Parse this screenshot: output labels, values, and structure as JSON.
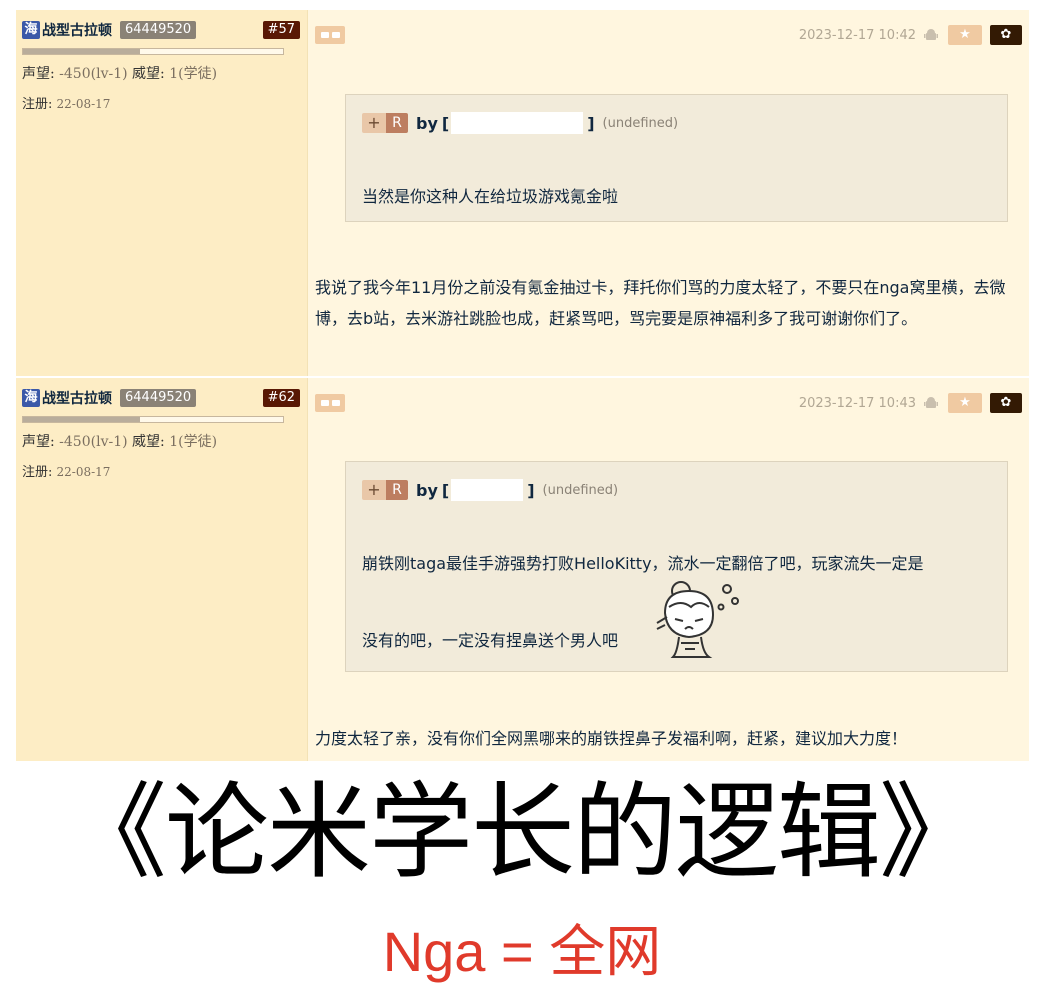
{
  "posts": [
    {
      "user": {
        "badge": "海",
        "name": "战型古拉顿",
        "uid": "64449520",
        "floor": "#57",
        "prestige_label": "声望: ",
        "prestige_value": "-450(lv-1)",
        "authority_label": " 威望: ",
        "authority_value": "1(学徒)",
        "reg_label": "注册: ",
        "reg_value": "22-08-17"
      },
      "date": "2023-12-17 10:42",
      "quote": {
        "plus": "+",
        "r": "R",
        "by": "by",
        "open_bracket": "[",
        "close_bracket": "]",
        "undefined": "(undefined)",
        "text": "当然是你这种人在给垃圾游戏氪金啦"
      },
      "body": "我说了我今年11月份之前没有氪金抽过卡，拜托你们骂的力度太轻了，不要只在nga窝里横，去微博，去b站，去米游社跳脸也成，赶紧骂吧，骂完要是原神福利多了我可谢谢你们了。"
    },
    {
      "user": {
        "badge": "海",
        "name": "战型古拉顿",
        "uid": "64449520",
        "floor": "#62",
        "prestige_label": "声望: ",
        "prestige_value": "-450(lv-1)",
        "authority_label": " 威望: ",
        "authority_value": "1(学徒)",
        "reg_label": "注册: ",
        "reg_value": "22-08-17"
      },
      "date": "2023-12-17 10:43",
      "quote": {
        "plus": "+",
        "r": "R",
        "by": "by",
        "open_bracket": "[",
        "close_bracket": "]",
        "undefined": "(undefined)",
        "text_line1": "崩铁刚taga最佳手游强势打败HelloKitty，流水一定翻倍了吧，玩家流失一定是",
        "text_line2": "没有的吧，一定没有捏鼻送个男人吧"
      },
      "body": "力度太轻了亲，没有你们全网黑哪来的崩铁捏鼻子发福利啊，赶紧，建议加大力度！"
    }
  ],
  "caption": {
    "title": "《论米学长的逻辑》",
    "subtitle": "Nga = 全网"
  },
  "icons": {
    "like": "thumbs-up-icon",
    "dislike": "thumbs-down-icon",
    "android": "android-icon",
    "star": "star-icon",
    "gear": "gear-icon",
    "sticker": "crying-girl-sticker"
  },
  "colors": {
    "post_bg": "#fff6df",
    "side_bg": "#fdedc5",
    "floor_badge": "#591804",
    "caption_red": "#e03a2b"
  }
}
